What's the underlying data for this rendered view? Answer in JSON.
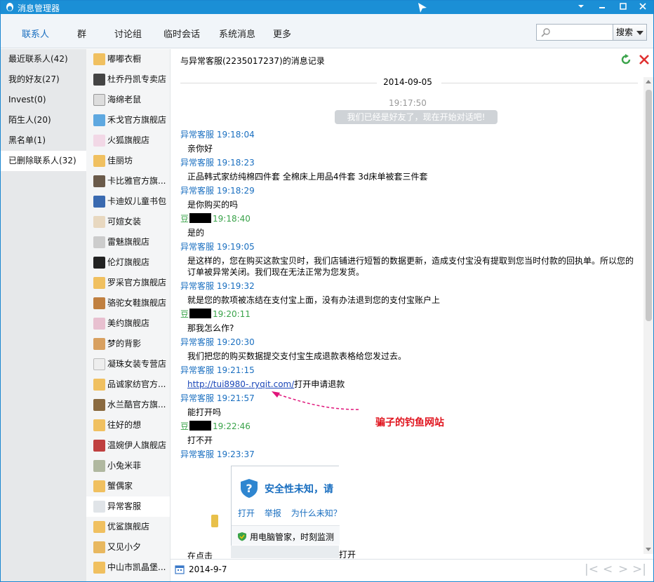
{
  "window": {
    "title": "消息管理器"
  },
  "tabs": [
    "联系人",
    "群",
    "讨论组",
    "临时会话",
    "系统消息",
    "更多"
  ],
  "search": {
    "placeholder": "",
    "button": "搜索"
  },
  "categories": [
    "最近联系人(42)",
    "我的好友(27)",
    "Invest(0)",
    "陌生人(20)",
    "黑名单(1)",
    "已删除联系人(32)"
  ],
  "contacts": [
    "嘟嘟衣橱",
    "杜乔丹凯专卖店",
    "海绵老鼠",
    "禾戈官方旗舰店",
    "火狐旗舰店",
    "佳丽坊",
    "卡比雅官方旗...",
    "卡迪奴儿童书包",
    "可媗女装",
    "雷魅旗舰店",
    "伦灯旗舰店",
    "罗采官方旗舰店",
    "骆驼女鞋旗舰店",
    "美约旗舰店",
    "梦的背影",
    "凝珠女装专营店",
    "品诚家纺官方...",
    "水兰酷官方旗...",
    "往好的想",
    "温婉伊人旗舰店",
    "小兔米菲",
    "蟹偶家",
    "异常客服",
    "优鲨旗舰店",
    "又见小夕",
    "中山市凯晶堡..."
  ],
  "colors": {
    "accent": "#1b8fd6",
    "link": "#1a46b8",
    "sender": "#1a6fc0",
    "me": "#3aa34a",
    "annotation": "#e0141e"
  },
  "chat": {
    "header": "与异常客服(2235017237)的消息记录",
    "date": "2014-09-05",
    "system_time": "19:17:50",
    "system_msg": "我们已经是好友了，现在开始对话吧!",
    "messages": [
      {
        "sender": "异常客服",
        "time": "19:18:04",
        "text": "亲你好"
      },
      {
        "sender": "异常客服",
        "time": "19:18:23",
        "text": "正品韩式家纺纯棉四件套 全棉床上用品4件套 3d床单被套三件套"
      },
      {
        "sender": "异常客服",
        "time": "19:18:29",
        "text": "是你购买的吗"
      },
      {
        "sender": "豆",
        "time": "19:18:40",
        "text": "是的"
      },
      {
        "sender": "异常客服",
        "time": "19:19:05",
        "text": "是这样的，您在购买这款宝贝时，我们店铺进行短暂的数据更新，造成支付宝没有提取到您当时付款的回执单。所以您的订单被异常关闭。我们现在无法正常为您发货。"
      },
      {
        "sender": "异常客服",
        "time": "19:19:32",
        "text": "就是您的款项被冻结在支付宝上面，没有办法退到您的支付宝账户上"
      },
      {
        "sender": "豆",
        "time": "19:20:11",
        "text": "那我怎么作?"
      },
      {
        "sender": "异常客服",
        "time": "19:20:30",
        "text": "我们把您的购买数据提交支付宝生成退款表格给您发过去。"
      },
      {
        "sender": "异常客服",
        "time": "19:21:15",
        "link": "http://tui8980-.ryqit.com/",
        "text": "打开申请退款"
      },
      {
        "sender": "异常客服",
        "time": "19:21:57",
        "text": "能打开吗"
      },
      {
        "sender": "豆",
        "time": "19:22:46",
        "text": "打不开"
      },
      {
        "sender": "异常客服",
        "time": "19:23:37",
        "text": ""
      }
    ],
    "annotation": "骗子的钓鱼网站",
    "popup": {
      "title": "安全性未知，请",
      "links": [
        "打开",
        "举报",
        "为什么未知？"
      ],
      "footer": "用电脑管家，时刻监测"
    },
    "trailing_left": "在点击",
    "trailing_right": "打开"
  },
  "footer": {
    "date": "2014-9-7"
  }
}
